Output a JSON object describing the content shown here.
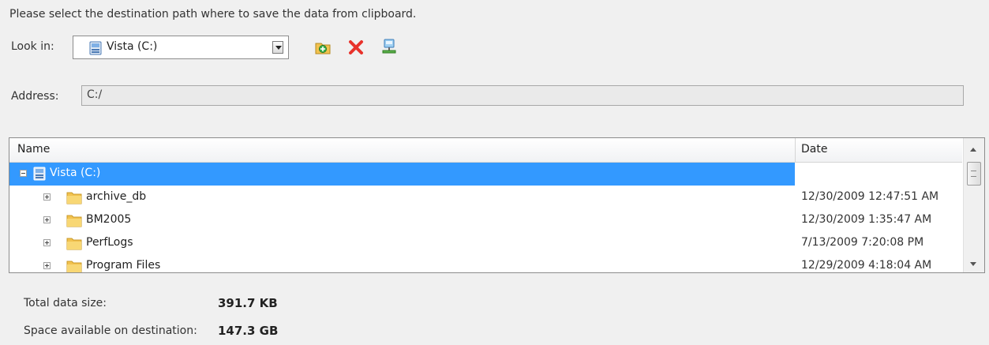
{
  "instruction": "Please select the destination path where to save the data from clipboard.",
  "look_in": {
    "label": "Look in:",
    "value": "Vista (C:)"
  },
  "toolbar": {
    "new_folder_icon": "new-folder-icon",
    "delete_icon": "delete-icon",
    "network_icon": "network-drive-icon"
  },
  "address": {
    "label": "Address:",
    "value": "C:/"
  },
  "tree": {
    "columns": [
      "Name",
      "Date"
    ],
    "root": {
      "name": "Vista (C:)",
      "date": ""
    },
    "items": [
      {
        "name": "archive_db",
        "date": "12/30/2009 12:47:51 AM"
      },
      {
        "name": "BM2005",
        "date": "12/30/2009 1:35:47 AM"
      },
      {
        "name": "PerfLogs",
        "date": "7/13/2009 7:20:08 PM"
      },
      {
        "name": "Program Files",
        "date": "12/29/2009 4:18:04 AM"
      }
    ]
  },
  "summary": {
    "total_label": "Total data size:",
    "total_value": "391.7 KB",
    "space_label": "Space available on destination:",
    "space_value": "147.3 GB"
  },
  "colors": {
    "selection": "#3399ff",
    "folder": "#f2c24f"
  }
}
